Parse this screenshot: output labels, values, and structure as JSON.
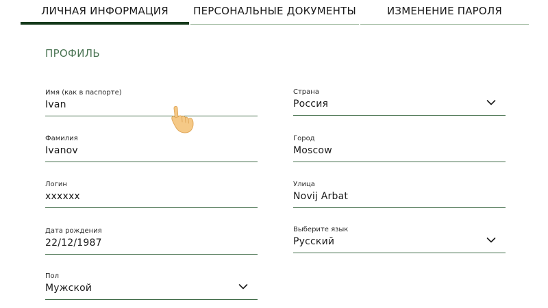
{
  "tabs": [
    {
      "label": "ЛИЧНАЯ ИНФОРМАЦИЯ",
      "active": true
    },
    {
      "label": "ПЕРСОНАЛЬНЫЕ ДОКУМЕНТЫ",
      "active": false
    },
    {
      "label": "ИЗМЕНЕНИЕ ПАРОЛЯ",
      "active": false
    }
  ],
  "section_title": "ПРОФИЛЬ",
  "left_fields": {
    "name": {
      "label": "Имя (как в паспорте)",
      "value": "Ivan"
    },
    "surname": {
      "label": "Фамилия",
      "value": "Ivanov"
    },
    "login": {
      "label": "Логин",
      "value": "xxxxxx"
    },
    "birth_date": {
      "label": "Дата рождения",
      "value": "22/12/1987"
    },
    "gender": {
      "label": "Пол",
      "value": "Мужской"
    }
  },
  "right_fields": {
    "country": {
      "label": "Страна",
      "value": "Россия"
    },
    "city": {
      "label": "Город",
      "value": "Moscow"
    },
    "street": {
      "label": "Улица",
      "value": "Novij Arbat"
    },
    "language": {
      "label": "Выберите язык",
      "value": "Русский"
    }
  },
  "icons": {
    "dropdown": "chevron-down-icon",
    "cursor": "hand-pointer-icon"
  },
  "colors": {
    "accent_dark": "#163a1c",
    "accent_light": "#9cb79c",
    "field_line": "#3f6b47",
    "section_title": "#4a7453",
    "cursor_fill": "#f5c987"
  }
}
